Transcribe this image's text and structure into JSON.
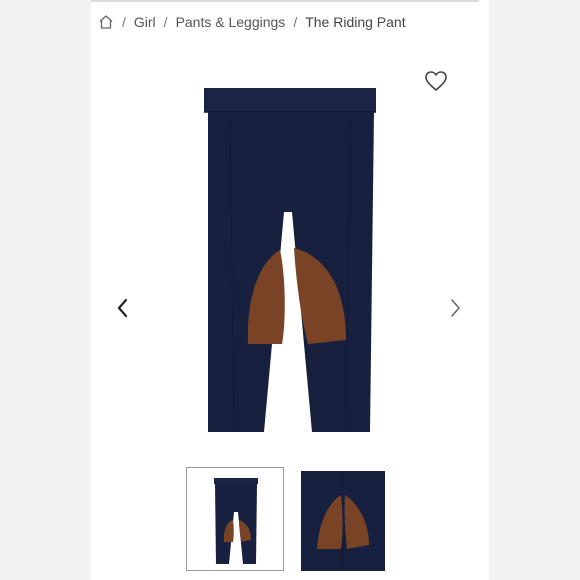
{
  "breadcrumb": {
    "home_icon": "home-icon",
    "separator": "/",
    "items": [
      {
        "label": "Girl"
      },
      {
        "label": "Pants & Leggings"
      },
      {
        "label": "The Riding Pant"
      }
    ]
  },
  "actions": {
    "favorite_icon": "heart-icon"
  },
  "gallery": {
    "prev_icon": "chevron-left-icon",
    "next_icon": "chevron-right-icon",
    "thumbnails": [
      {
        "selected": true
      },
      {
        "selected": false
      }
    ]
  },
  "colors": {
    "navy": "#17203f",
    "suede": "#7a4326",
    "thumb_border": "#9a9a9a"
  }
}
